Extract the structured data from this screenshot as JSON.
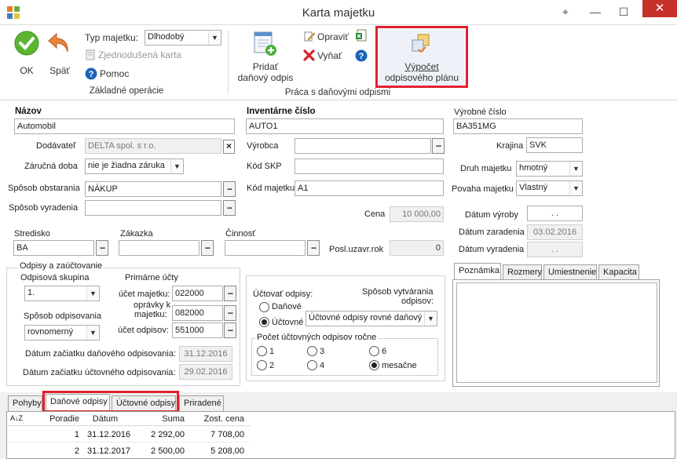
{
  "window": {
    "title": "Karta majetku",
    "pin_glyph": "⌖",
    "min_glyph": "—",
    "max_glyph": "☐",
    "close_glyph": "✕"
  },
  "ribbon": {
    "ok_label": "OK",
    "back_label": "Späť",
    "typ_label": "Typ majetku:",
    "typ_value": "Dlhodobý",
    "simple_card_label": "Zjednodušená karta",
    "help_label": "Pomoc",
    "group_basic": "Základné operácie",
    "add_tax_line1": "Pridať",
    "add_tax_line2": "daňový odpis",
    "edit_label": "Opraviť",
    "remove_label": "Vyňať",
    "calc_line1": "Výpočet",
    "calc_line2": "odpisového plánu",
    "group_tax": "Práca s daňovými odpismi"
  },
  "form": {
    "nazov_label": "Názov",
    "nazov_value": "Automobil",
    "dodavatel_label": "Dodávateľ",
    "dodavatel_value": "DELTA spol. s r.o.",
    "zarucna_label": "Záručná doba",
    "zarucna_value": "nie je žiadna záruka",
    "obstarania_label": "Spôsob obstarania",
    "obstarania_value": "NÁKUP",
    "vyradenia_label": "Spôsob vyradenia",
    "vyradenia_value": "",
    "inv_label": "Inventárne číslo",
    "inv_value": "AUTO1",
    "vyrobca_label": "Výrobca",
    "vyrobca_value": "",
    "skp_label": "Kód SKP",
    "skp_value": "",
    "kod_label": "Kód majetku",
    "kod_value": "A1",
    "cena_label": "Cena",
    "cena_value": "10 000,00",
    "vyr_cislo_label": "Výrobné číslo",
    "vyr_cislo_value": "BA351MG",
    "krajina_label": "Krajina",
    "krajina_value": "SVK",
    "druh_label": "Druh majetku",
    "druh_value": "hmotný",
    "povaha_label": "Povaha majetku",
    "povaha_value": "Vlastný",
    "dat_vyroby_label": "Dátum výroby",
    "dat_vyroby_value": ". .",
    "dat_zaradenia_label": "Dátum zaradenia",
    "dat_zaradenia_value": "03.02.2016",
    "dat_vyradenia_label": "Dátum vyradenia",
    "dat_vyradenia_value": ". .",
    "stredisko_label": "Stredisko",
    "stredisko_value": "BA",
    "zakazka_label": "Zákazka",
    "zakazka_value": "",
    "cinnost_label": "Činnosť",
    "cinnost_value": "",
    "posl_label": "Posl.uzavr.rok",
    "posl_value": "0",
    "odpisy_title": "Odpisy a zaúčtovanie",
    "skupina_label": "Odpisová skupina",
    "skupina_value": "1.",
    "sposob_odp_label": "Spôsob odpisovania",
    "sposob_odp_value": "rovnomerný",
    "primarne_label": "Primárne účty",
    "ucet_majetku_label": "účet majetku:",
    "ucet_majetku_value": "022000",
    "opravky_label1": "oprávky k",
    "opravky_label2": "majetku:",
    "opravky_value": "082000",
    "ucet_odpisov_label": "účet odpisov:",
    "ucet_odpisov_value": "551000",
    "dat_dan_label": "Dátum začiatku daňového odpisovania:",
    "dat_dan_value": "31.12.2016",
    "dat_uct_label": "Dátum začiatku účtovného odpisovania:",
    "dat_uct_value": "29.02.2016",
    "uctovat_label": "Účtovať odpisy:",
    "danove_label": "Daňové",
    "uctovne_label": "Účtovné",
    "vytvarania_label1": "Spôsob vytvárania",
    "vytvarania_label2": "odpisov:",
    "vytvarania_value": "Účtovné odpisy rovné daňový",
    "pocet_label": "Počet účtovných odpisov ročne",
    "r1": "1",
    "r2": "2",
    "r3": "3",
    "r4": "4",
    "r6": "6",
    "rm": "mesačne",
    "right_tabs": [
      "Poznámka",
      "Rozmery",
      "Umiestnenie",
      "Kapacita"
    ]
  },
  "bottom_tabs": [
    "Pohyby",
    "Daňové odpisy",
    "Účtovné odpisy",
    "Priradené"
  ],
  "grid": {
    "sort_icon_label": "A↓Z",
    "columns": [
      "Poradie",
      "Dátum",
      "Suma",
      "Zost. cena"
    ],
    "rows": [
      [
        "1",
        "31.12.2016",
        "2 292,00",
        "7 708,00"
      ],
      [
        "2",
        "31.12.2017",
        "2 500,00",
        "5 208,00"
      ]
    ]
  },
  "colors": {
    "accent_red": "#e0202e",
    "ok_green": "#5cb531",
    "back_orange": "#e8833a",
    "help_blue": "#1c64b8"
  }
}
